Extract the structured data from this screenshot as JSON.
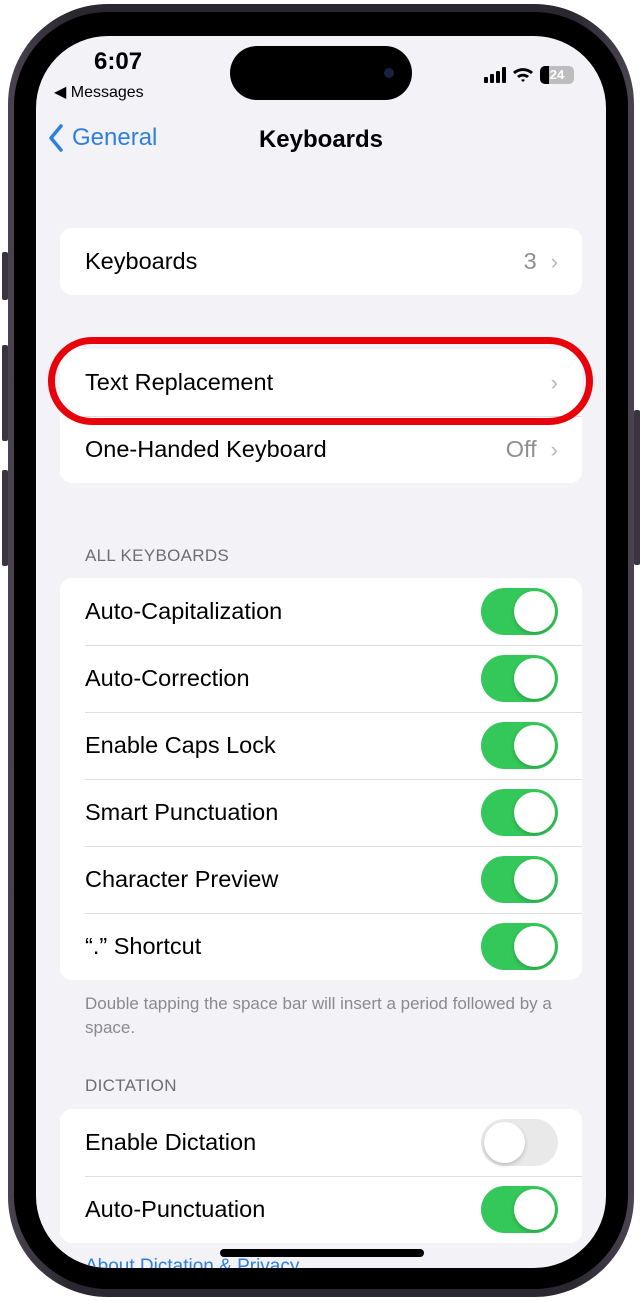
{
  "status_bar": {
    "time": "6:07",
    "back_app": "◀ Messages",
    "battery": "24"
  },
  "nav": {
    "back_label": "General",
    "title": "Keyboards"
  },
  "group1": [
    {
      "label": "Keyboards",
      "value": "3"
    }
  ],
  "group2": [
    {
      "label": "Text Replacement",
      "value": ""
    },
    {
      "label": "One-Handed Keyboard",
      "value": "Off"
    }
  ],
  "all_keyboards": {
    "header": "ALL KEYBOARDS",
    "items": [
      {
        "label": "Auto-Capitalization",
        "on": true
      },
      {
        "label": "Auto-Correction",
        "on": true
      },
      {
        "label": "Enable Caps Lock",
        "on": true
      },
      {
        "label": "Smart Punctuation",
        "on": true
      },
      {
        "label": "Character Preview",
        "on": true
      },
      {
        "label": "“.” Shortcut",
        "on": true
      }
    ],
    "footer": "Double tapping the space bar will insert a period followed by a space."
  },
  "dictation": {
    "header": "DICTATION",
    "items": [
      {
        "label": "Enable Dictation",
        "on": false
      },
      {
        "label": "Auto-Punctuation",
        "on": true
      }
    ],
    "link": "About Dictation & Privacy"
  },
  "colors": {
    "accent": "#2f7fe0",
    "toggle_on": "#34c759",
    "highlight": "#e8000b"
  }
}
